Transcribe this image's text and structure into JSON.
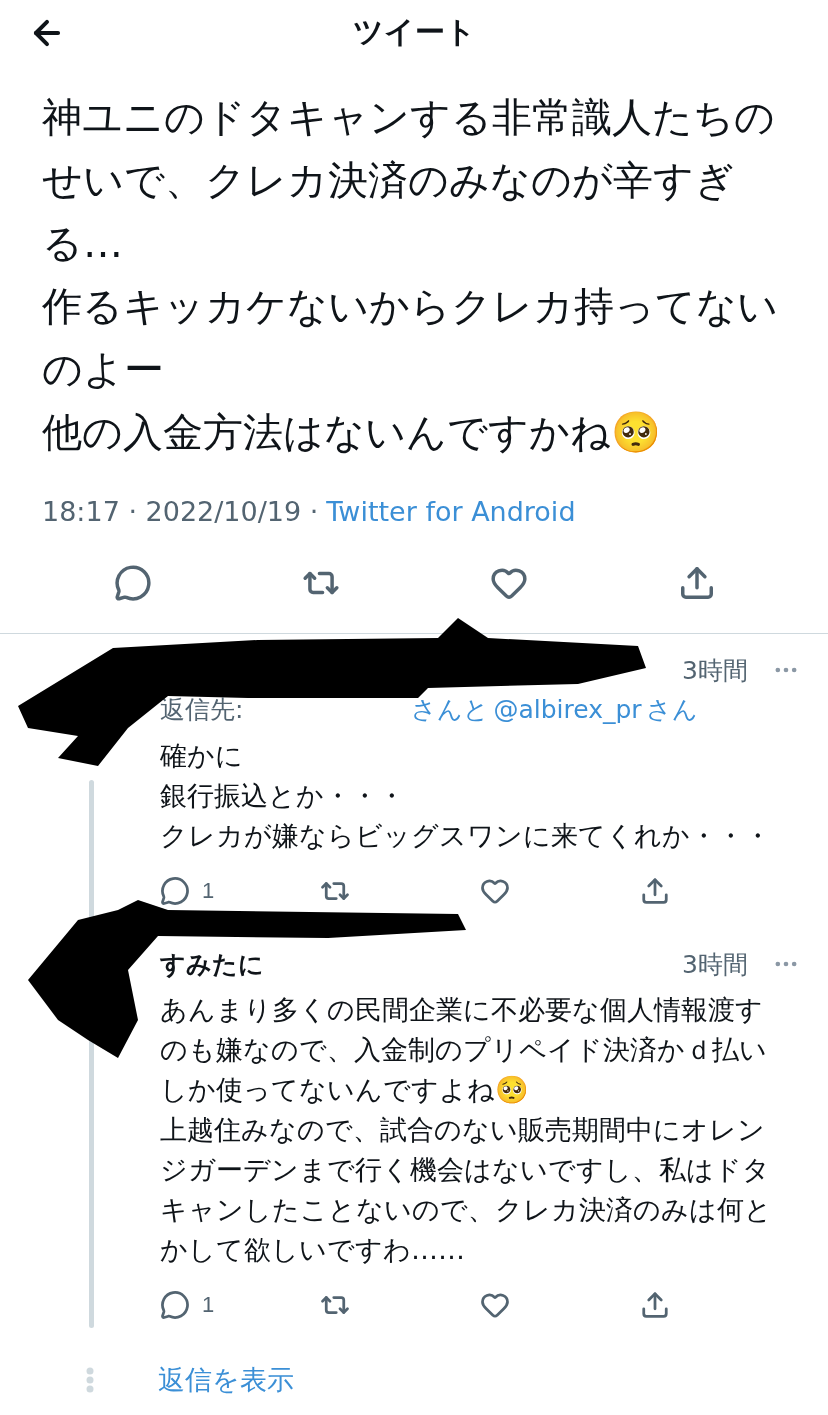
{
  "header": {
    "title": "ツイート"
  },
  "tweet": {
    "paragraphs": [
      "神ユニのドタキャンする非常識人たちのせいで、クレカ決済のみなのが辛すぎる…",
      "作るキッカケないからクレカ持ってないのよー",
      "他の入金方法はないんですかね🥺"
    ],
    "timestamp": "18:17 · 2022/10/19 ·",
    "source": "Twitter for Android"
  },
  "replies": [
    {
      "time": "3時間",
      "reply_to": {
        "prefix": "返信先:",
        "middle": "さんと",
        "handle": "@albirex_pr",
        "suffix": "さん"
      },
      "paragraphs": [
        "確かに",
        "銀行振込とか・・・",
        "クレカが嫌ならビッグスワンに来てくれか・・・"
      ],
      "reply_count": "1"
    },
    {
      "name": "すみたに",
      "time": "3時間",
      "paragraphs": [
        "あんまり多くの民間企業に不必要な個人情報渡すのも嫌なので、入金制のプリペイド決済かｄ払いしか使ってないんですよね🥺",
        "上越住みなので、試合のない販売期間中にオレンジガーデンまで行く機会はないですし、私はドタキャンしたことないので、クレカ決済のみは何とかして欲しいですわ……"
      ],
      "reply_count": "1"
    }
  ],
  "show_replies": "返信を表示"
}
